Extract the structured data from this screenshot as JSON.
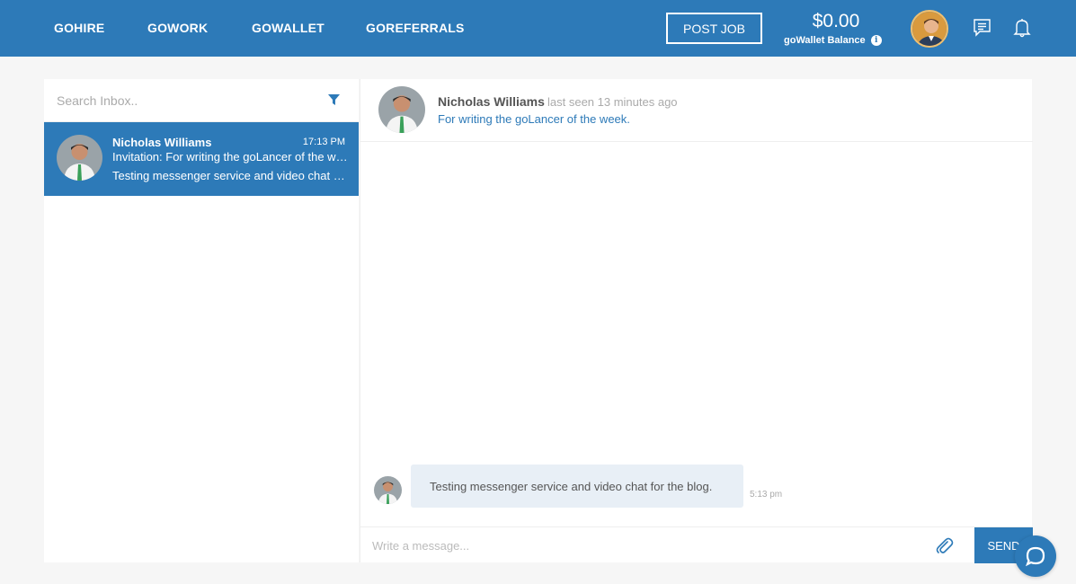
{
  "nav": {
    "items": [
      {
        "label": "GOHIRE"
      },
      {
        "label": "GOWORK"
      },
      {
        "label": "GOWALLET"
      },
      {
        "label": "GOREFERRALS"
      }
    ],
    "post_job_label": "POST JOB",
    "wallet_amount": "$0.00",
    "wallet_label": "goWallet Balance",
    "info_glyph": "i"
  },
  "inbox": {
    "search_placeholder": "Search Inbox..",
    "conversations": [
      {
        "name": "Nicholas Williams",
        "time": "17:13 PM",
        "subject": "Invitation: For writing the goLancer of the week.",
        "preview": "Testing messenger service and video chat for the blog."
      }
    ]
  },
  "chat": {
    "name": "Nicholas Williams",
    "last_seen": "last seen 13 minutes ago",
    "subject": "For writing the goLancer of the week.",
    "messages": [
      {
        "text": "Testing messenger service and video chat for the blog.",
        "time": "5:13 pm"
      }
    ],
    "composer_placeholder": "Write a message...",
    "send_label": "SEND"
  },
  "colors": {
    "brand": "#2d7ab8",
    "bubble": "#e8eff6",
    "background": "#f6f6f6"
  },
  "icons": [
    "filter-icon",
    "chat-icon",
    "bell-icon",
    "paperclip-icon",
    "help-chat-icon",
    "info-icon"
  ]
}
